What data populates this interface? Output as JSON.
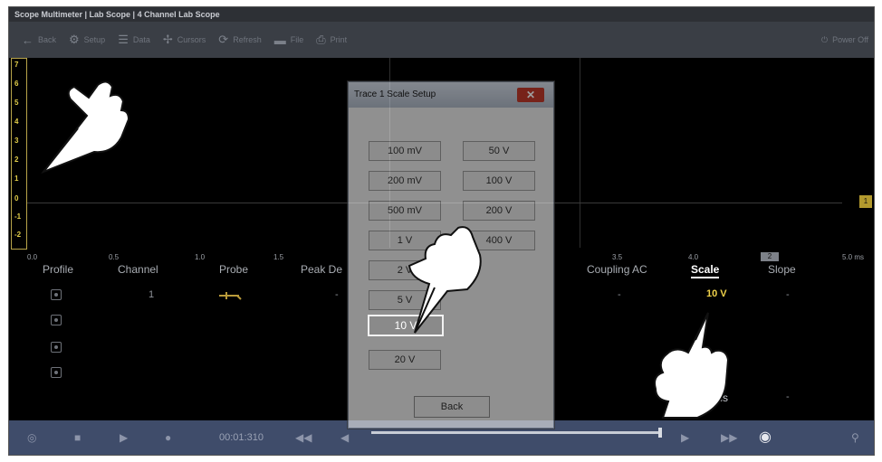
{
  "window": {
    "title": "Scope Multimeter | Lab Scope | 4 Channel Lab Scope"
  },
  "toolbar": {
    "back": "Back",
    "setup": "Setup",
    "data": "Data",
    "cursors": "Cursors",
    "refresh": "Refresh",
    "file": "File",
    "print": "Print",
    "power_off": "Power Off"
  },
  "scope": {
    "y_ticks": [
      "7",
      "6",
      "5",
      "4",
      "3",
      "2",
      "1",
      "0",
      "-1",
      "-2"
    ],
    "x_ticks": [
      "0.0",
      "0.5",
      "1.0",
      "1.5",
      "3.5",
      "4.0",
      "5.0 ms"
    ],
    "channel_marker": "1",
    "x_marker": "2"
  },
  "columns": [
    "Profile",
    "Channel",
    "Probe",
    "Peak De",
    "Coupling AC",
    "Scale",
    "Slope"
  ],
  "row1": {
    "channel": "1",
    "peak": "-",
    "coupling": "-",
    "scale": "10 V",
    "slope": "-"
  },
  "row_bottom": {
    "time": "5 ms",
    "slope": "-"
  },
  "bottom_bar": {
    "timer": "00:01:310"
  },
  "dialog": {
    "title": "Trace 1 Scale Setup",
    "close": "✕",
    "left_options": [
      "100 mV",
      "200 mV",
      "500 mV",
      "1 V",
      "2 V",
      "5 V",
      "10 V",
      "20 V"
    ],
    "right_options": [
      "50 V",
      "100 V",
      "200 V",
      "400 V"
    ],
    "selected": "10 V",
    "back": "Back"
  }
}
